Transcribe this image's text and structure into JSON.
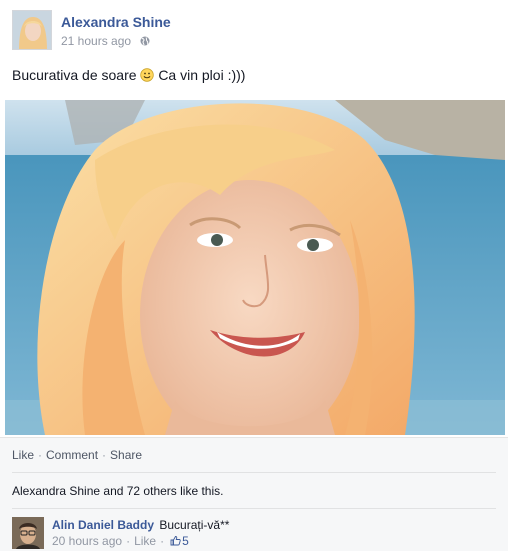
{
  "post": {
    "author": "Alexandra Shine",
    "timestamp": "21 hours ago",
    "privacy_icon": "globe-icon",
    "status_text_before": "Bucurativa de soare",
    "emoticon": "smiley-icon",
    "status_text_after": "Ca vin ploi :)))"
  },
  "actions": {
    "like": "Like",
    "comment": "Comment",
    "share": "Share",
    "separator": "·"
  },
  "likes": {
    "text": "Alexandra Shine and 72 others like this."
  },
  "comment": {
    "author": "Alin Daniel Baddy",
    "text": "Bucurați-vă**",
    "timestamp": "20 hours ago",
    "like": "Like",
    "like_count": "5",
    "like_icon": "thumbs-up-icon"
  },
  "colors": {
    "link_blue": "#3b5998",
    "muted": "#9197a3",
    "actions_bg": "#f6f7f8"
  }
}
